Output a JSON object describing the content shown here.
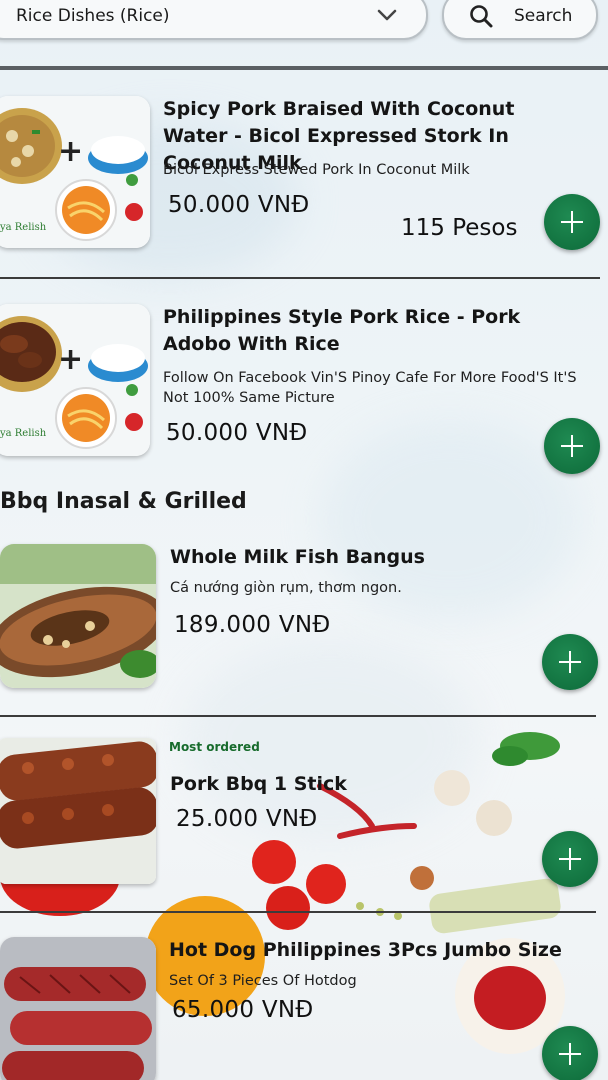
{
  "topbar": {
    "category": "Rice Dishes (Rice)",
    "search_label": "Search"
  },
  "items": [
    {
      "name": "Spicy Pork Braised With Coconut Water - Bicol Expressed Stork In Coconut Milk",
      "description": "Bicol Express Stewed Pork In Coconut Milk",
      "price": "50.000 VNĐ",
      "price_alt": "115 Pesos",
      "thumb_caption": "aya Relish"
    },
    {
      "name": "Philippines Style Pork Rice - Pork Adobo With Rice",
      "description": "Follow On Facebook Vin'S Pinoy Cafe For More Food'S It'S Not 100% Same Picture",
      "price": "50.000 VNĐ",
      "thumb_caption": "aya Relish"
    },
    {
      "name": "Whole Milk Fish Bangus",
      "description": "Cá nướng giòn rụm, thơm ngon.",
      "price": "189.000 VNĐ"
    },
    {
      "name": "Pork Bbq 1 Stick",
      "badge": "Most ordered",
      "price": "25.000 VNĐ"
    },
    {
      "name": "Hot Dog Philippines 3Pcs Jumbo Size",
      "description": "Set Of 3 Pieces Of Hotdog",
      "price": "65.000 VNĐ"
    }
  ],
  "section": {
    "title": "Bbq Inasal & Grilled"
  },
  "colors": {
    "add_button": "#0d6a39",
    "badge": "#176b2c"
  }
}
